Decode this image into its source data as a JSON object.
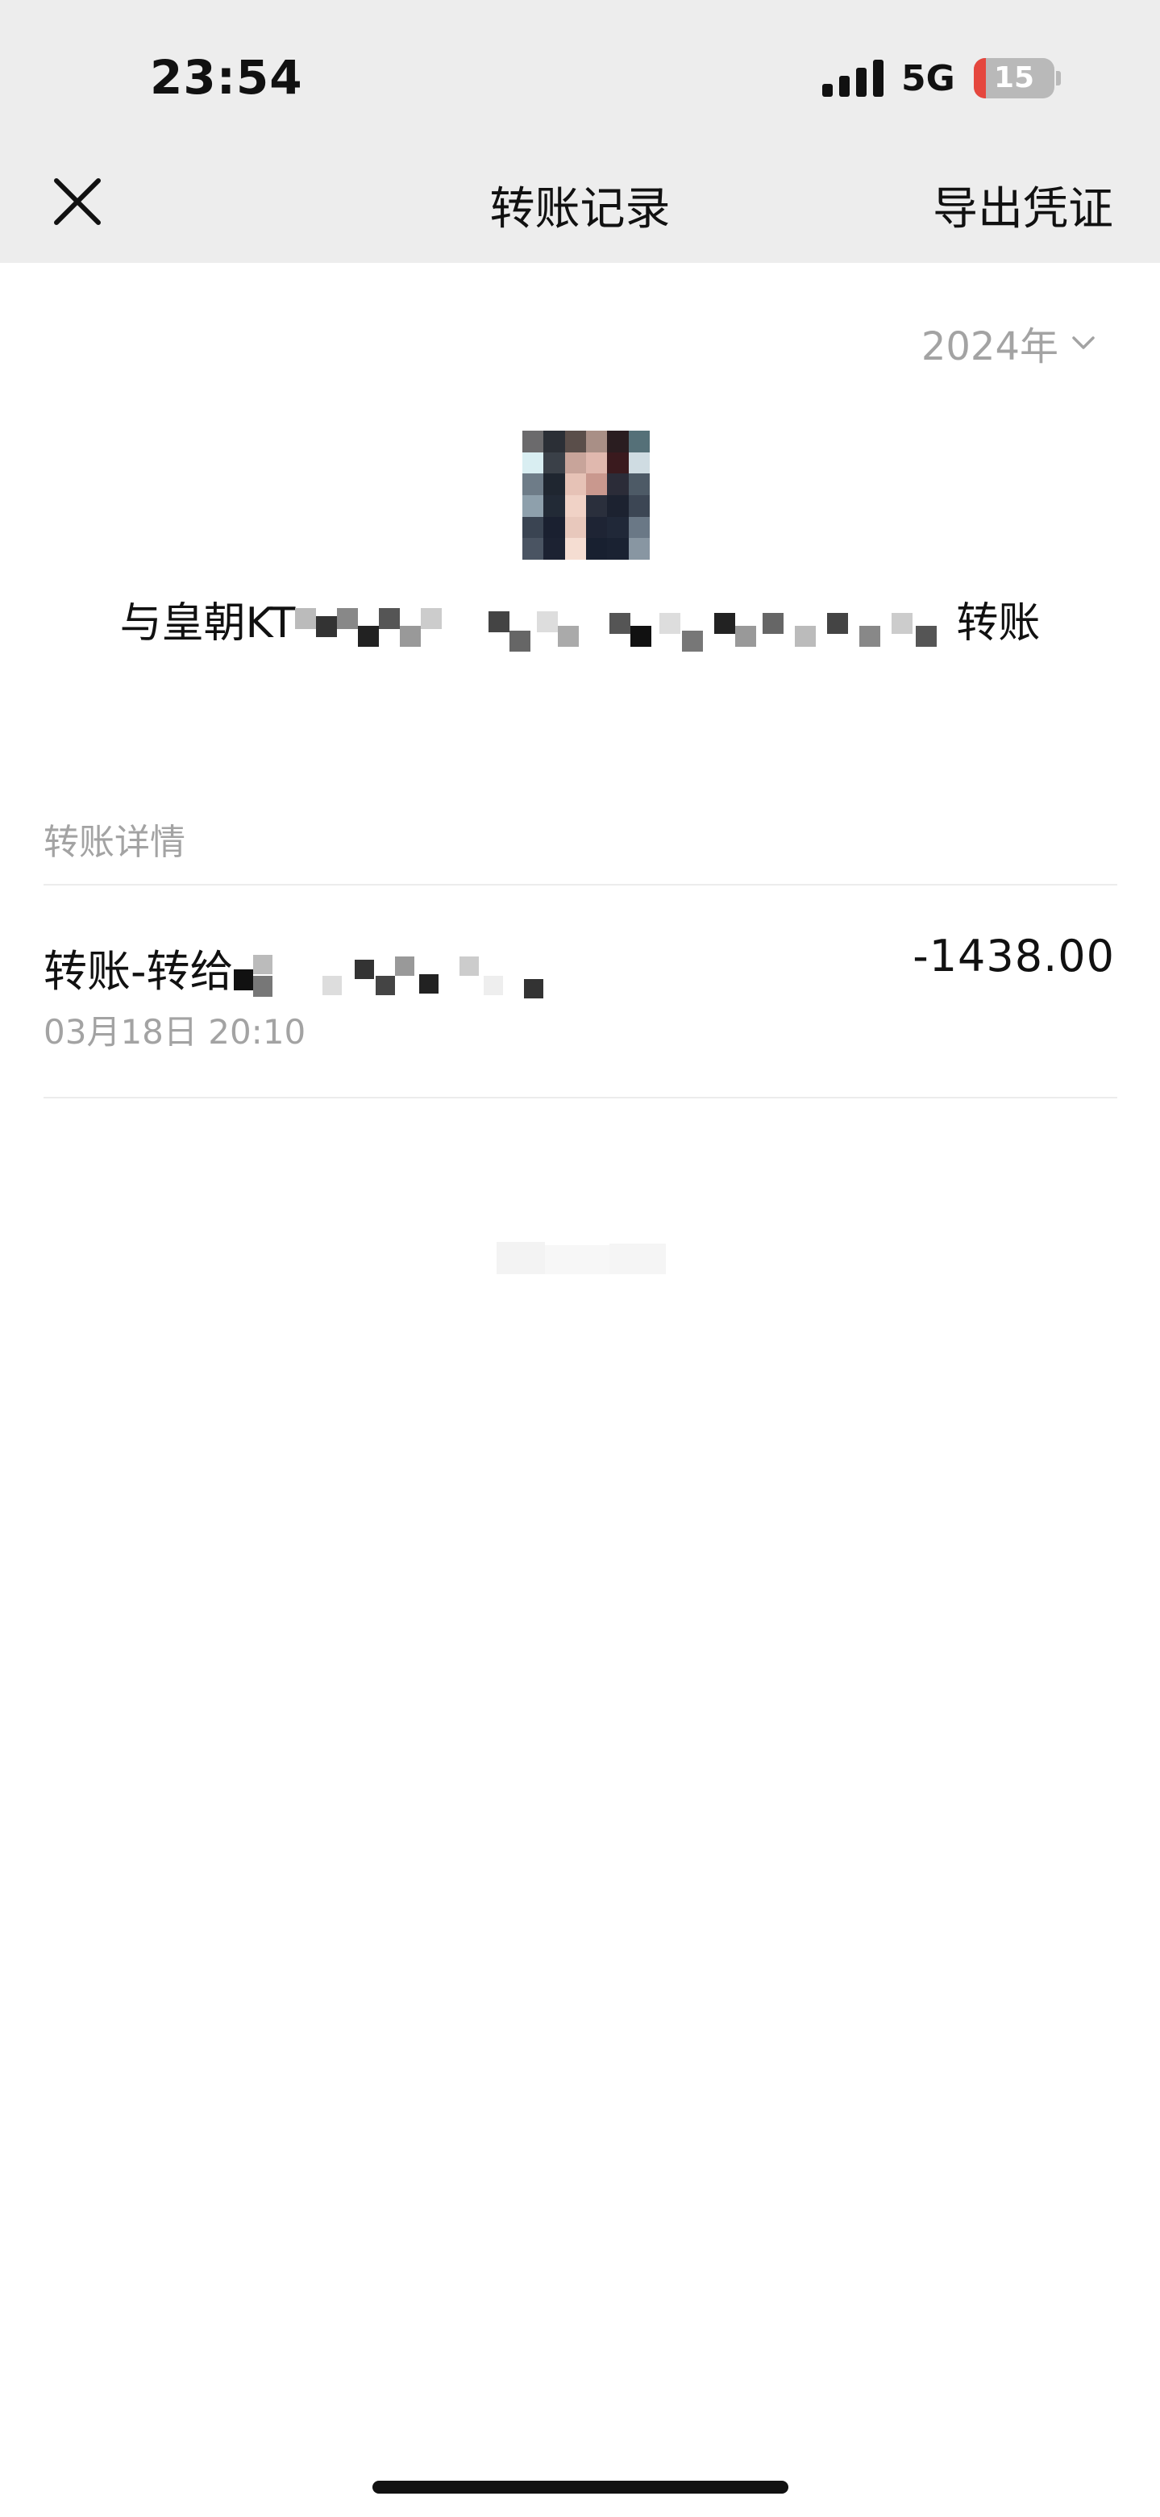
{
  "status_bar": {
    "time": "23:54",
    "network": "5G",
    "battery_level": "15",
    "battery_fraction": 0.15,
    "battery_color": "#e5473e"
  },
  "header": {
    "close_icon": "close-icon",
    "title": "转账记录",
    "export_label": "导出凭证"
  },
  "filter": {
    "year_label": "2024年",
    "dropdown_icon": "chevron-down-icon"
  },
  "counterpart": {
    "name_prefix": "与皇朝KT",
    "name_suffix": "转账"
  },
  "section": {
    "label": "转账详情"
  },
  "records": [
    {
      "title": "转账-转给",
      "time": "03月18日 20:10",
      "amount": "-1438.00"
    }
  ],
  "colors": {
    "header_bg": "#ededed",
    "secondary_text": "#a3a3a3",
    "primary_text": "#111111"
  }
}
